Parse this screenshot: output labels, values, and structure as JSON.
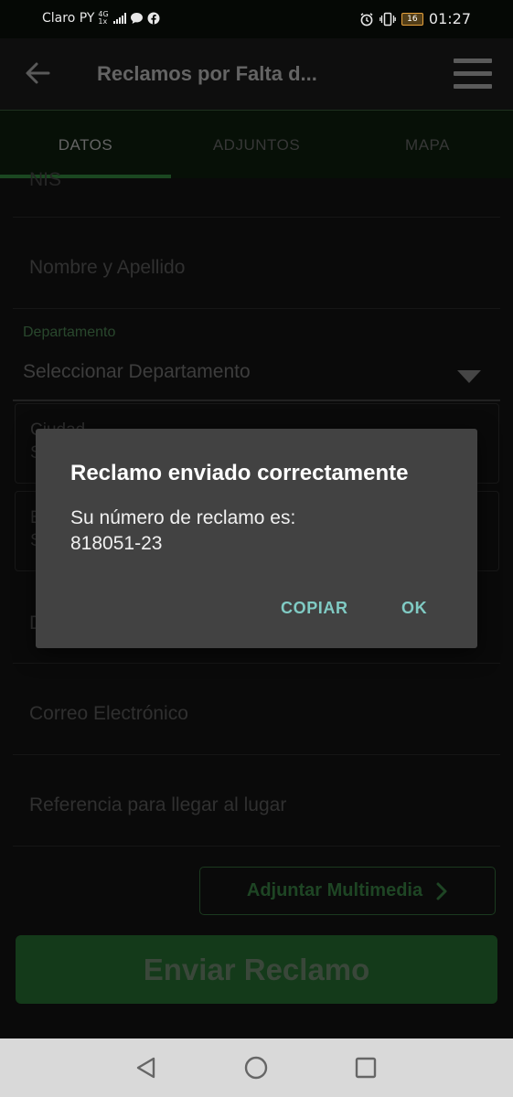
{
  "status_bar": {
    "carrier": "Claro PY",
    "network_top": "4G",
    "network_bottom": "1x",
    "battery": "16",
    "time": "01:27",
    "icons": [
      "signal-icon",
      "chat-bubble-icon",
      "facebook-icon",
      "alarm-icon",
      "vibrate-icon",
      "battery-icon"
    ]
  },
  "app_bar": {
    "title": "Reclamos por Falta d...",
    "icons": [
      "back-arrow-icon",
      "hamburger-menu-icon"
    ]
  },
  "tabs": [
    {
      "label": "DATOS",
      "active": true
    },
    {
      "label": "ADJUNTOS",
      "active": false
    },
    {
      "label": "MAPA",
      "active": false
    }
  ],
  "form": {
    "nis_partial": "NIS",
    "nombre_placeholder": "Nombre y Apellido",
    "departamento_label": "Departamento",
    "departamento_value": "Seleccionar Departamento",
    "ciudad_partial_label": "Ciudad",
    "ciudad_partial_value": "S",
    "barrio_partial_label": "B",
    "barrio_partial_value": "S",
    "direccion_partial": "D",
    "correo_placeholder": "Correo Electrónico",
    "referencia_placeholder": "Referencia para llegar al lugar",
    "attach_label": "Adjuntar Multimedia",
    "send_label": "Enviar Reclamo"
  },
  "dialog": {
    "title": "Reclamo enviado correctamente",
    "message_line1": "Su número de reclamo es:",
    "message_line2": "818051-23",
    "copy_label": "COPIAR",
    "ok_label": "OK"
  },
  "nav_bar": {
    "icons": [
      "back-triangle-icon",
      "home-circle-icon",
      "recents-square-icon"
    ]
  },
  "colors": {
    "accent_green": "#2a6e34",
    "dialog_button": "#80cbc4",
    "dialog_bg": "#424242"
  }
}
